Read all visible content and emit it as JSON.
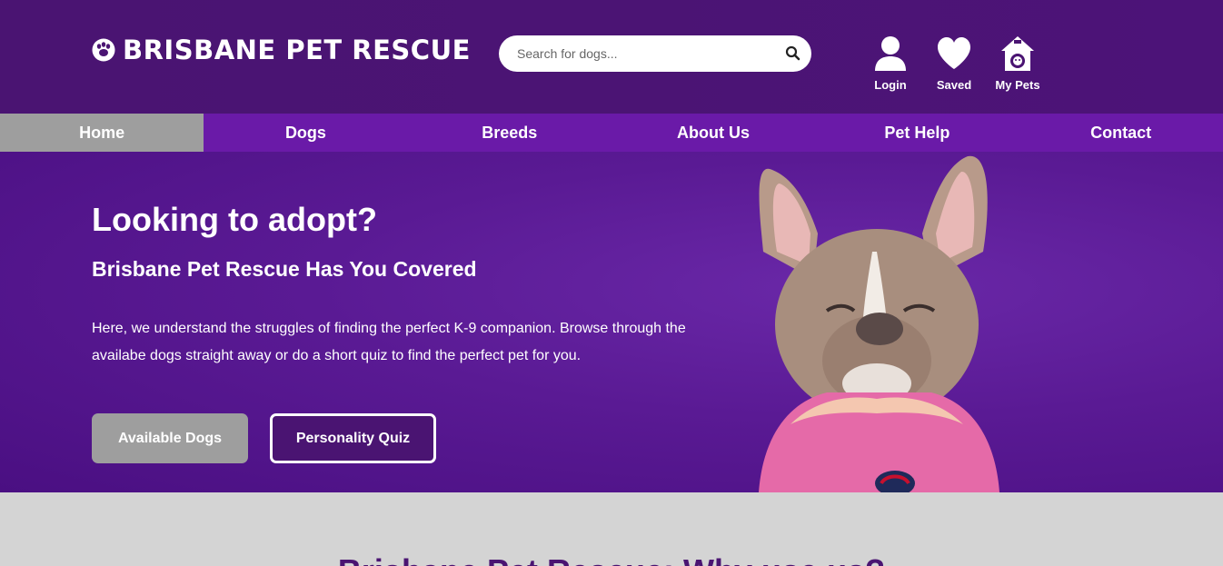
{
  "header": {
    "brand_name": "BRISBANE PET RESCUE",
    "search_placeholder": "Search for dogs...",
    "icons": [
      {
        "label": "Login",
        "icon": "user-icon"
      },
      {
        "label": "Saved",
        "icon": "heart-icon"
      },
      {
        "label": "My Pets",
        "icon": "pet-house-icon"
      }
    ]
  },
  "nav": {
    "items": [
      "Home",
      "Dogs",
      "Breeds",
      "About Us",
      "Pet Help",
      "Contact"
    ],
    "active": "Home"
  },
  "hero": {
    "title": "Looking to adopt?",
    "subtitle": "Brisbane Pet Rescue Has You Covered",
    "body": "Here, we understand the struggles of finding the perfect K-9 companion. Browse through the availabe dogs straight away or do a short quiz to find the perfect pet for you.",
    "primary_button": "Available Dogs",
    "secondary_button": "Personality Quiz"
  },
  "section": {
    "title": "Brisbane Pet Rescue: Why use us?"
  },
  "colors": {
    "header_bg": "#4a1472",
    "nav_bg": "#6a1aa8",
    "active_nav_bg": "#9e9e9e",
    "hero_bg": "#5a1a94",
    "section_bg": "#d4d4d4"
  }
}
